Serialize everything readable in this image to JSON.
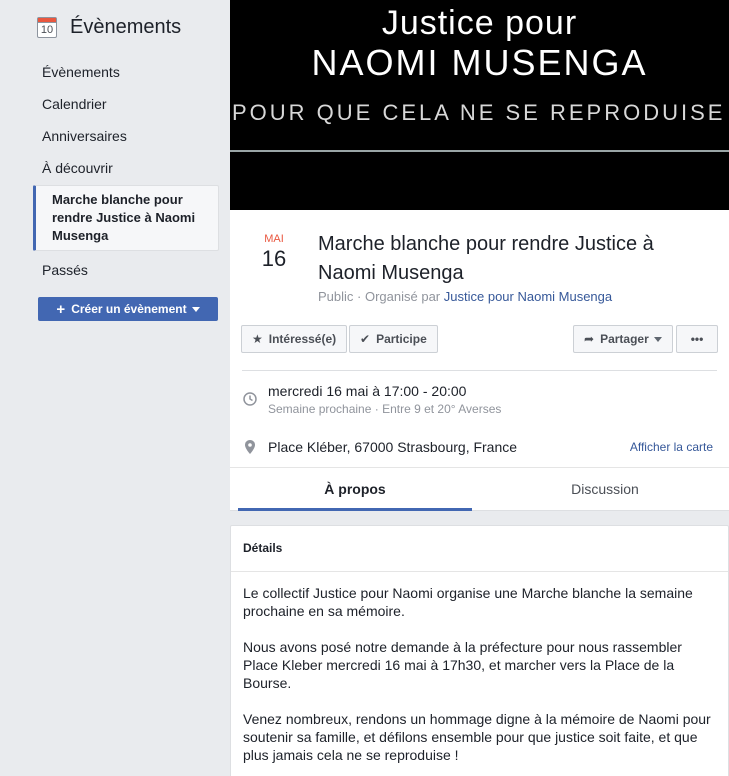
{
  "sidebar": {
    "icon_day": "10",
    "title": "Évènements",
    "items": [
      {
        "label": "Évènements"
      },
      {
        "label": "Calendrier"
      },
      {
        "label": "Anniversaires"
      },
      {
        "label": "À découvrir"
      },
      {
        "label": "Marche blanche pour rendre Justice à Naomi Musenga"
      },
      {
        "label": "Passés"
      }
    ],
    "create_label": "Créer un évènement"
  },
  "cover": {
    "line1": "Justice pour",
    "line2": "NAOMI MUSENGA",
    "line3": "POUR QUE CELA NE SE REPRODUISE PLUS"
  },
  "event": {
    "month": "MAI",
    "day": "16",
    "title": "Marche blanche pour rendre Justice à Naomi Musenga",
    "privacy": "Public",
    "organized_by": "Organisé par",
    "organizer": "Justice pour Naomi Musenga",
    "buttons": {
      "interested": "Intéressé(e)",
      "going": "Participe",
      "share": "Partager",
      "more": "•••"
    },
    "time": "mercredi 16 mai à 17:00 - 20:00",
    "time_sub": "Semaine prochaine · Entre 9 et 20° Averses",
    "place": "Place Kléber, 67000 Strasbourg, France",
    "map_link": "Afficher la carte",
    "tabs": [
      {
        "label": "À propos"
      },
      {
        "label": "Discussion"
      }
    ]
  },
  "details": {
    "heading": "Détails",
    "paragraphs": [
      "Le collectif Justice pour Naomi organise une Marche blanche la semaine prochaine en sa mémoire.",
      "Nous avons posé notre demande à la préfecture pour nous rassembler Place Kleber mercredi 16 mai à 17h30, et marcher vers la Place de la Bourse.",
      "Venez nombreux, rendons un hommage digne à la mémoire de Naomi pour soutenir sa famille, et défilons ensemble pour que justice soit faite, et que plus jamais cela ne se reproduise !"
    ]
  }
}
